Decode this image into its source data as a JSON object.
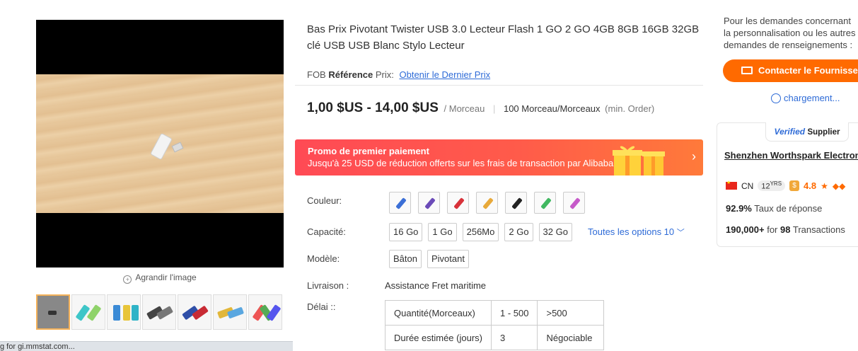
{
  "gallery": {
    "enlarge_label": "Agrandir l'image",
    "status_text": "g for gi.mmstat.com..."
  },
  "product": {
    "title": "Bas Prix Pivotant Twister USB 3.0 Lecteur Flash 1 GO 2 GO 4GB 8GB 16GB 32GB clé USB USB Blanc Stylo Lecteur",
    "fob_prefix": "FOB",
    "fob_ref": "Référence",
    "fob_price": "Prix:",
    "fob_link": "Obtenir le Dernier Prix",
    "price_range": "1,00 $US - 14,00 $US",
    "price_unit": "/ Morceau",
    "moq": "100 Morceau/Morceaux",
    "moq_min": "(min. Order)"
  },
  "promo": {
    "title": "Promo de premier paiement",
    "text": "Jusqu'à 25 USD de réduction offerts sur les frais de transaction par Alibaba.com",
    "chevron": "›"
  },
  "options": {
    "color_label": "Couleur:",
    "swatch_colors": [
      "#3b6fd6",
      "#6b4bb8",
      "#d8323a",
      "#e8a93a",
      "#222222",
      "#41b861",
      "#c65ac9"
    ],
    "capacity_label": "Capacité:",
    "capacities": [
      "16 Go",
      "1 Go",
      "256Mo",
      "2 Go",
      "32 Go"
    ],
    "all_options": "Toutes les options 10",
    "model_label": "Modèle:",
    "models": [
      "Bâton",
      "Pivotant"
    ],
    "delivery_label": "Livraison :",
    "delivery_value": "Assistance Fret maritime",
    "delay_label": "Délai ::",
    "delay_table": {
      "row1": [
        "Quantité(Morceaux)",
        "1 - 500",
        ">500"
      ],
      "row2": [
        "Durée estimée (jours)",
        "3",
        "Négociable"
      ]
    }
  },
  "supplier": {
    "note": [
      "Pour les demandes concernant",
      "la personnalisation ou les autres",
      "demandes de renseignements :"
    ],
    "contact_label": "Contacter le Fournisseur",
    "loading": "chargement...",
    "verified": "Verified",
    "supplier_word": "Supplier",
    "company": "Shenzhen Worthspark Electronics",
    "country": "CN",
    "years": "12",
    "years_suffix": "YRS",
    "gold_glyph": "$",
    "rating": "4.8",
    "response_rate": "92.9%",
    "response_label": "Taux de réponse",
    "transactions_amount": "190,000+",
    "transactions_for": "for",
    "transactions_count": "98",
    "transactions_label": "Transactions"
  }
}
